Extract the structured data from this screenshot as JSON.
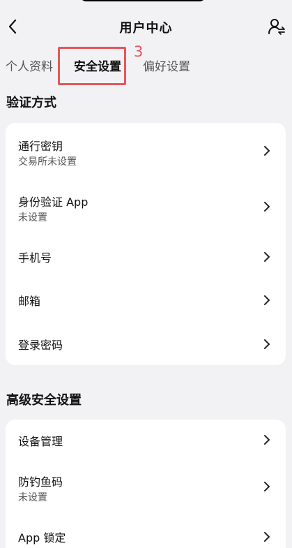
{
  "header": {
    "title": "用户中心",
    "back_icon": "chevron-left-icon",
    "right_icon": "user-switch-icon"
  },
  "tabs": [
    {
      "label": "个人资料",
      "active": false
    },
    {
      "label": "安全设置",
      "active": true
    },
    {
      "label": "偏好设置",
      "active": false
    }
  ],
  "annotation": {
    "number": "3",
    "color": "#e8555a"
  },
  "sections": [
    {
      "title": "验证方式",
      "items": [
        {
          "label": "通行密钥",
          "sub": "交易所未设置"
        },
        {
          "label": "身份验证 App",
          "sub": "未设置"
        },
        {
          "label": "手机号"
        },
        {
          "label": "邮箱"
        },
        {
          "label": "登录密码"
        }
      ]
    },
    {
      "title": "高级安全设置",
      "items": [
        {
          "label": "设备管理"
        },
        {
          "label": "防钓鱼码",
          "sub": "未设置"
        },
        {
          "label": "App 锁定"
        }
      ]
    }
  ]
}
